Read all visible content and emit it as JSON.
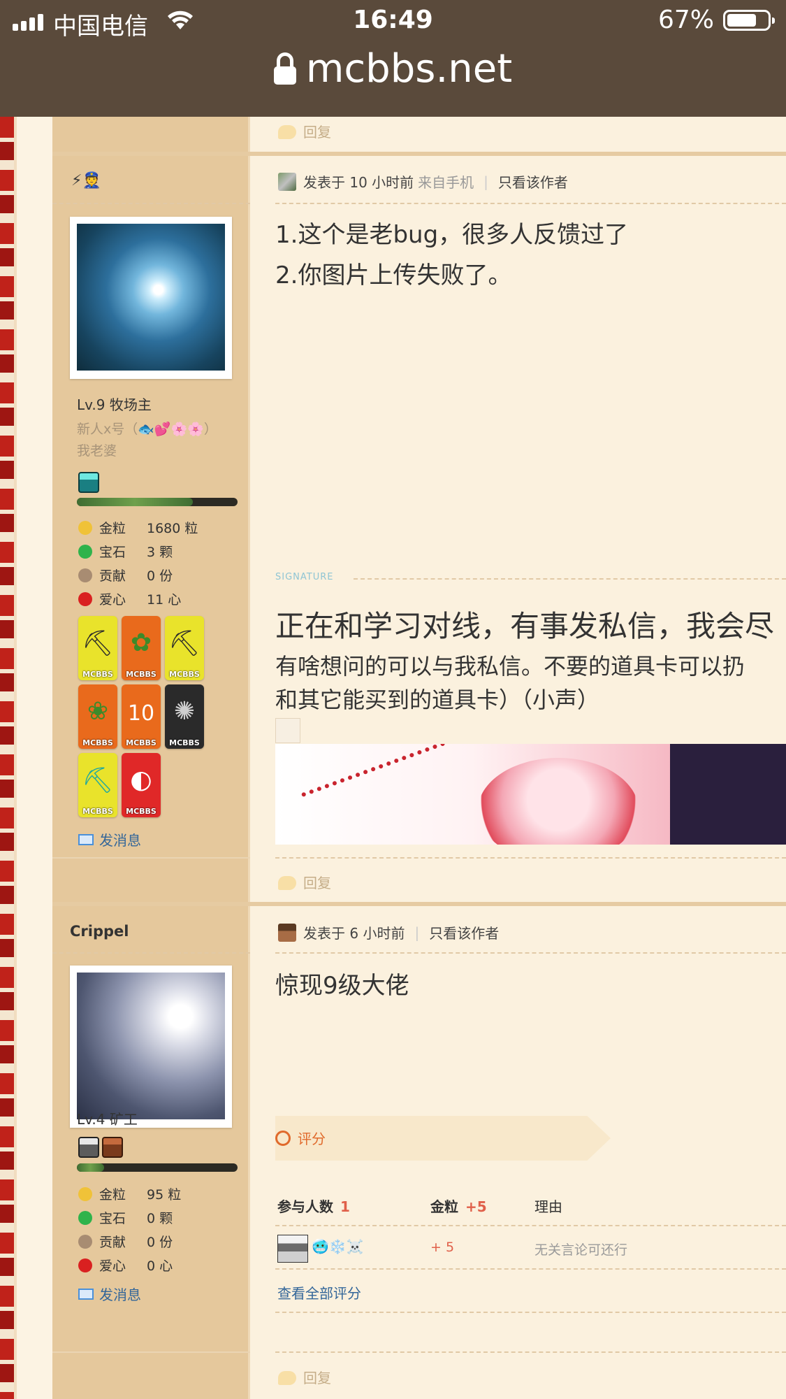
{
  "status_bar": {
    "carrier": "中国电信",
    "time": "16:49",
    "battery": "67%"
  },
  "browser": {
    "url": "mcbbs.net"
  },
  "reply_label": "回复",
  "post1": {
    "user_badges": "⚡👮",
    "level": "Lv.9 牧场主",
    "custom_title_line1": "新人x号（🐟💕🌸🌸）",
    "custom_title_line2": "我老婆",
    "progress": 0.72,
    "stats": [
      {
        "key": "金粒",
        "value": "1680 粒"
      },
      {
        "key": "宝石",
        "value": "3 颗"
      },
      {
        "key": "贡献",
        "value": "0 份"
      },
      {
        "key": "爱心",
        "value": "11 心"
      }
    ],
    "medal_label": "MCBBS",
    "send_message": "发消息",
    "meta_prefix": "发表于 10 小时前",
    "meta_from": "来自手机",
    "only_author": "只看该作者",
    "line1": "1.这个是老bug，很多人反馈过了",
    "line2": "2.你图片上传失败了。",
    "signature_label": "SIGNATURE",
    "sig_line1": "正在和学习对线，有事发私信，我会尽",
    "sig_line2": "有啥想问的可以与我私信。不要的道具卡可以扔",
    "sig_line3": "和其它能买到的道具卡）（小声）"
  },
  "post2": {
    "username": "Crippel",
    "level": "Lv.4 矿工",
    "progress": 0.17,
    "stats": [
      {
        "key": "金粒",
        "value": "95 粒"
      },
      {
        "key": "宝石",
        "value": "0 颗"
      },
      {
        "key": "贡献",
        "value": "0 份"
      },
      {
        "key": "爱心",
        "value": "0 心"
      }
    ],
    "send_message": "发消息",
    "meta_prefix": "发表于 6 小时前",
    "only_author": "只看该作者",
    "text": "惊现9级大佬",
    "rating": {
      "title": "评分",
      "col_participants": "参与人数",
      "participants": "1",
      "col_gold": "金粒",
      "gold_total": "+5",
      "col_reason": "理由",
      "row_emojis": "🥶❄️☠️",
      "row_gold": "+ 5",
      "row_reason": "无关言论可还行",
      "view_all": "查看全部评分"
    }
  },
  "colors": {
    "sidebar": "#e5c89c",
    "content": "#fbf1de",
    "link": "#336699",
    "accent": "#e06a2c"
  }
}
